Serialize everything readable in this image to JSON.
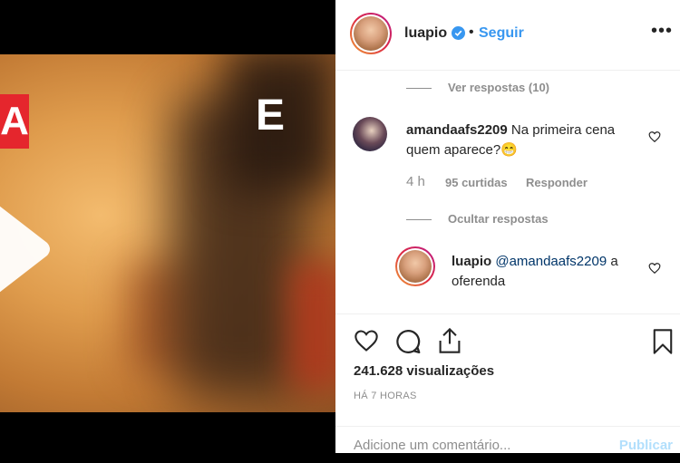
{
  "media": {
    "overlay_left_letter": "A",
    "overlay_right_letter": "E"
  },
  "header": {
    "username": "luapio",
    "separator": "•",
    "follow_label": "Seguir",
    "more_label": "•••"
  },
  "comments": {
    "view_replies": "Ver respostas (10)",
    "comment": {
      "username": "amandaafs2209",
      "text_line1": "Na primeira cena",
      "text_line2": "quem aparece?😁",
      "time": "4 h",
      "likes": "95 curtidas",
      "reply_label": "Responder"
    },
    "hide_replies": "Ocultar respostas",
    "reply": {
      "username": "luapio",
      "mention": "@amandaafs2209",
      "text_after": "a",
      "text_line2": "oferenda"
    }
  },
  "stats": {
    "views": "241.628 visualizações",
    "time_ago": "HÁ 7 HORAS"
  },
  "composer": {
    "placeholder": "Adicione um comentário...",
    "publish_label": "Publicar"
  },
  "colors": {
    "link": "#3897f0",
    "verified": "#3897f0",
    "publish_disabled": "#b2dffc"
  },
  "icons": [
    "play-icon",
    "verified-badge-icon",
    "more-options-icon",
    "heart-icon",
    "comment-icon",
    "share-icon",
    "bookmark-icon"
  ]
}
